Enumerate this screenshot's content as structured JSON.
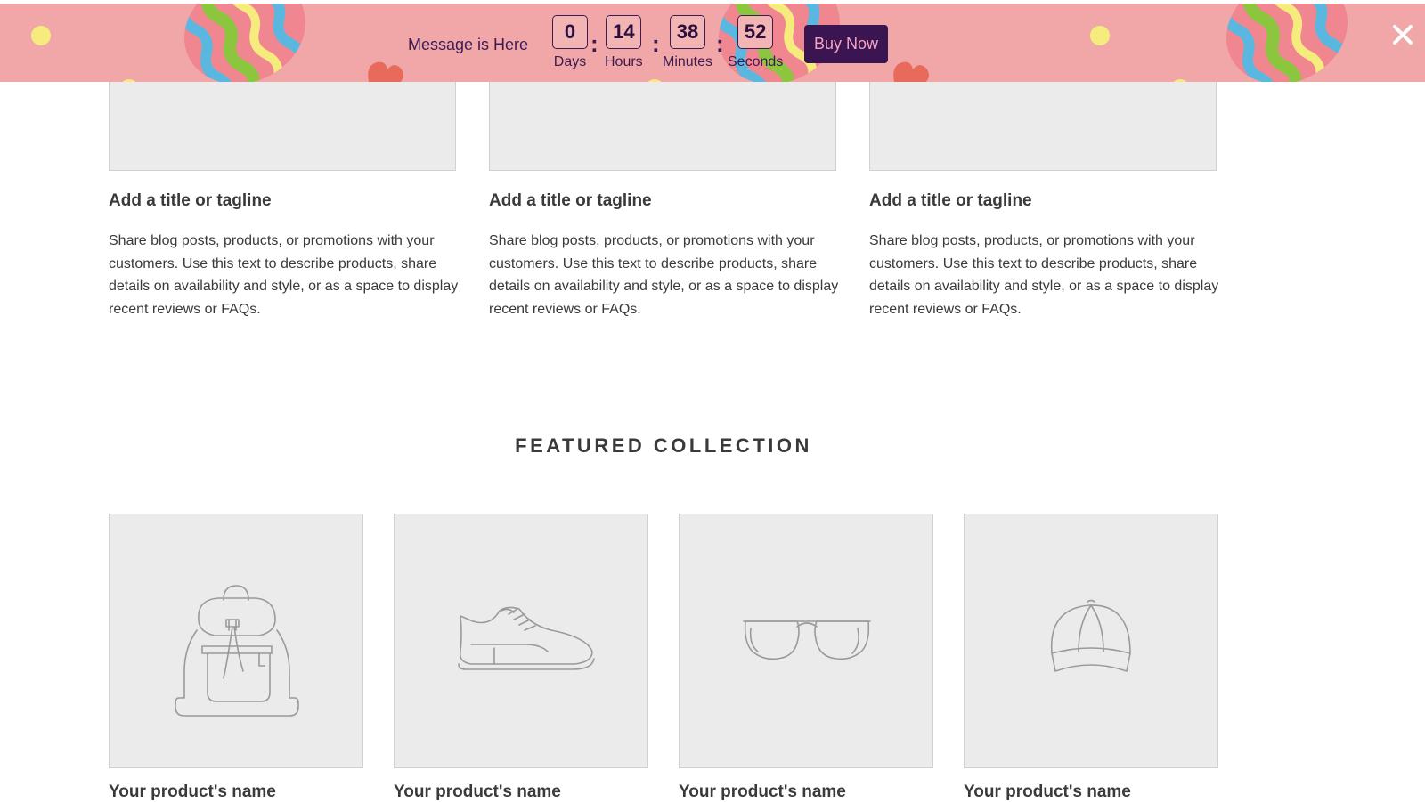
{
  "banner": {
    "message": "Message is Here",
    "countdown": [
      {
        "value": "0",
        "label": "Days"
      },
      {
        "value": "14",
        "label": "Hours"
      },
      {
        "value": "38",
        "label": "Minutes"
      },
      {
        "value": "52",
        "label": "Seconds"
      }
    ],
    "separator": ":",
    "buy_label": "Buy Now",
    "close_icon": "close-icon",
    "colors": {
      "background": "#f1a7a8",
      "button": "#3a1552",
      "button_text": "#f5a3c0",
      "text": "#3d1a52"
    }
  },
  "blog_cards": [
    {
      "title": "Add a title or tagline",
      "text": "Share blog posts, products, or promotions with your customers. Use this text to describe products, share details on availability and style, or as a space to display recent reviews or FAQs."
    },
    {
      "title": "Add a title or tagline",
      "text": "Share blog posts, products, or promotions with your customers. Use this text to describe products, share details on availability and style, or as a space to display recent reviews or FAQs."
    },
    {
      "title": "Add a title or tagline",
      "text": "Share blog posts, products, or promotions with your customers. Use this text to describe products, share details on availability and style, or as a space to display recent reviews or FAQs."
    }
  ],
  "featured": {
    "title": "FEATURED COLLECTION",
    "products": [
      {
        "name": "Your product's name",
        "icon": "backpack-icon"
      },
      {
        "name": "Your product's name",
        "icon": "sneaker-icon"
      },
      {
        "name": "Your product's name",
        "icon": "sunglasses-icon"
      },
      {
        "name": "Your product's name",
        "icon": "cap-icon"
      }
    ]
  }
}
